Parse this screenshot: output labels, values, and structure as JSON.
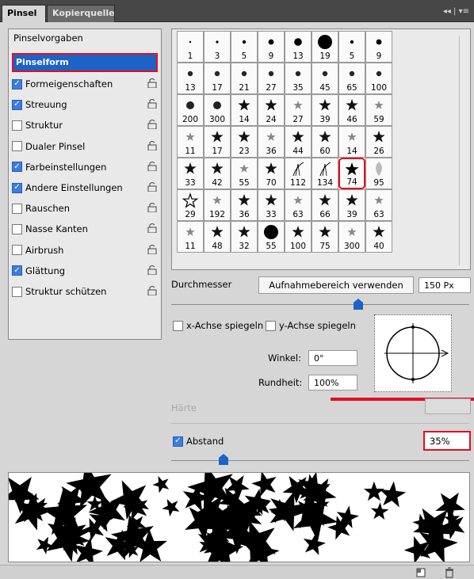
{
  "tabs": {
    "active": "Pinsel",
    "inactive": "Kopierquelle",
    "controls": "◂◂ | ▾≡"
  },
  "left": {
    "preset_label": "Pinselvorgaben",
    "selected_label": "Pinselform",
    "items": [
      {
        "label": "Formeigenschaften",
        "checked": true
      },
      {
        "label": "Streuung",
        "checked": true
      },
      {
        "label": "Struktur",
        "checked": false
      },
      {
        "label": "Dualer Pinsel",
        "checked": false
      },
      {
        "label": "Farbeinstellungen",
        "checked": true
      },
      {
        "label": "Andere Einstellungen",
        "checked": true
      },
      {
        "label": "Rauschen",
        "checked": false
      },
      {
        "label": "Nasse Kanten",
        "checked": false
      },
      {
        "label": "Airbrush",
        "checked": false
      },
      {
        "label": "Glättung",
        "checked": true
      },
      {
        "label": "Struktur schützen",
        "checked": false
      }
    ]
  },
  "grid": {
    "rows": [
      [
        "1",
        "3",
        "5",
        "9",
        "13",
        "19",
        "5",
        "9"
      ],
      [
        "13",
        "17",
        "21",
        "27",
        "35",
        "45",
        "65",
        "100"
      ],
      [
        "200",
        "300",
        "14",
        "24",
        "27",
        "39",
        "46",
        "59"
      ],
      [
        "11",
        "17",
        "23",
        "36",
        "44",
        "60",
        "14",
        "26"
      ],
      [
        "33",
        "42",
        "55",
        "70",
        "112",
        "134",
        "74",
        "95"
      ],
      [
        "29",
        "192",
        "36",
        "33",
        "63",
        "66",
        "39",
        "63"
      ],
      [
        "11",
        "48",
        "32",
        "55",
        "100",
        "75",
        "300",
        "40"
      ]
    ],
    "selected": "74"
  },
  "diameter": {
    "label": "Durchmesser",
    "button": "Aufnahmebereich verwenden",
    "value": "150 Px"
  },
  "flip": {
    "x_label": "x-Achse spiegeln",
    "y_label": "y-Achse spiegeln"
  },
  "angle": {
    "label": "Winkel:",
    "value": "0°"
  },
  "roundness": {
    "label": "Rundheit:",
    "value": "100%"
  },
  "hardness": {
    "label": "Härte"
  },
  "spacing": {
    "label": "Abstand",
    "value": "35%",
    "checked": true
  }
}
